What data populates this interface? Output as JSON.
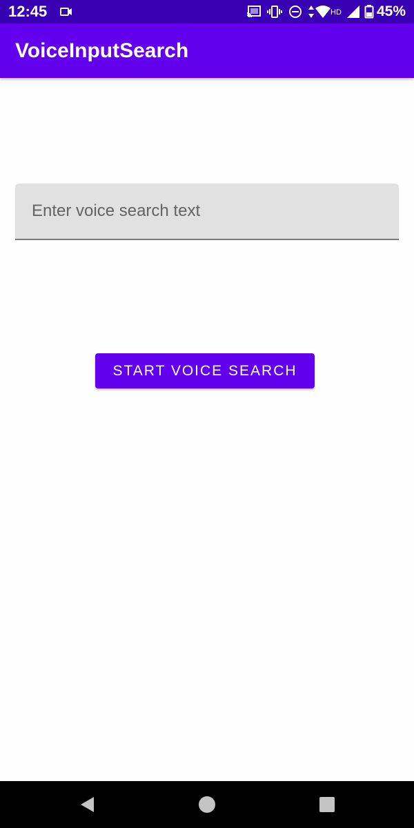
{
  "status_bar": {
    "time": "12:45",
    "battery_percent": "45%",
    "icons": [
      "video-camera-icon",
      "cast-icon",
      "vibrate-icon",
      "do-not-disturb-icon",
      "data-arrows-icon",
      "wifi-icon",
      "hd-icon",
      "signal-icon",
      "battery-icon"
    ]
  },
  "app_bar": {
    "title": "VoiceInputSearch"
  },
  "search": {
    "placeholder": "Enter voice search text",
    "value": ""
  },
  "voice_button": {
    "label": "START VOICE SEARCH"
  },
  "nav_bar": {
    "icons": [
      "back-icon",
      "home-icon",
      "recents-icon"
    ]
  },
  "colors": {
    "status_bar": "#3700b3",
    "primary": "#6200ee",
    "field_background": "#e1e1e1",
    "background": "#fefefe",
    "nav_bar": "#000000"
  }
}
